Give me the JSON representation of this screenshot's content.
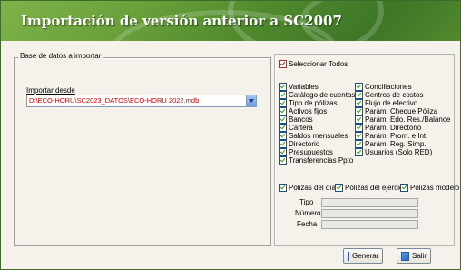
{
  "window": {
    "title": "Importación de versión anterior a SC2007"
  },
  "left_group": {
    "legend": "Base de datos a importar",
    "import_label": "Importar desde",
    "import_value": "D:\\ECO-HORU\\SC2023_DATOS\\ECO-HORU 2022.mdb"
  },
  "right_group": {
    "select_all": "Seleccionar Todos",
    "col1": [
      "Variables",
      "Catálogo de cuentas",
      "Tipo de pólizas",
      "Activos fijos",
      "Bancos",
      "Cartera",
      "Saldos mensuales",
      "Directorio",
      "Presupuestos",
      "Transferencias Ppto"
    ],
    "col2": [
      "Conciliaciones",
      "Centros de costos",
      "Flujo de efectivo",
      "Parám. Cheque Póliza",
      "Parám. Edo. Res./Balance",
      "Parám. Directorio",
      "Parám. Prom. e Int.",
      "Parám. Reg. Simp.",
      "Usuarios (Solo RED)"
    ],
    "policies": [
      "Pólizas del día",
      "Pólizas del ejercicio",
      "Pólizas modelo"
    ],
    "fields": [
      "Tipo",
      "Número",
      "Fecha"
    ]
  },
  "buttons": {
    "generate": "Generar",
    "exit": "Salir"
  }
}
